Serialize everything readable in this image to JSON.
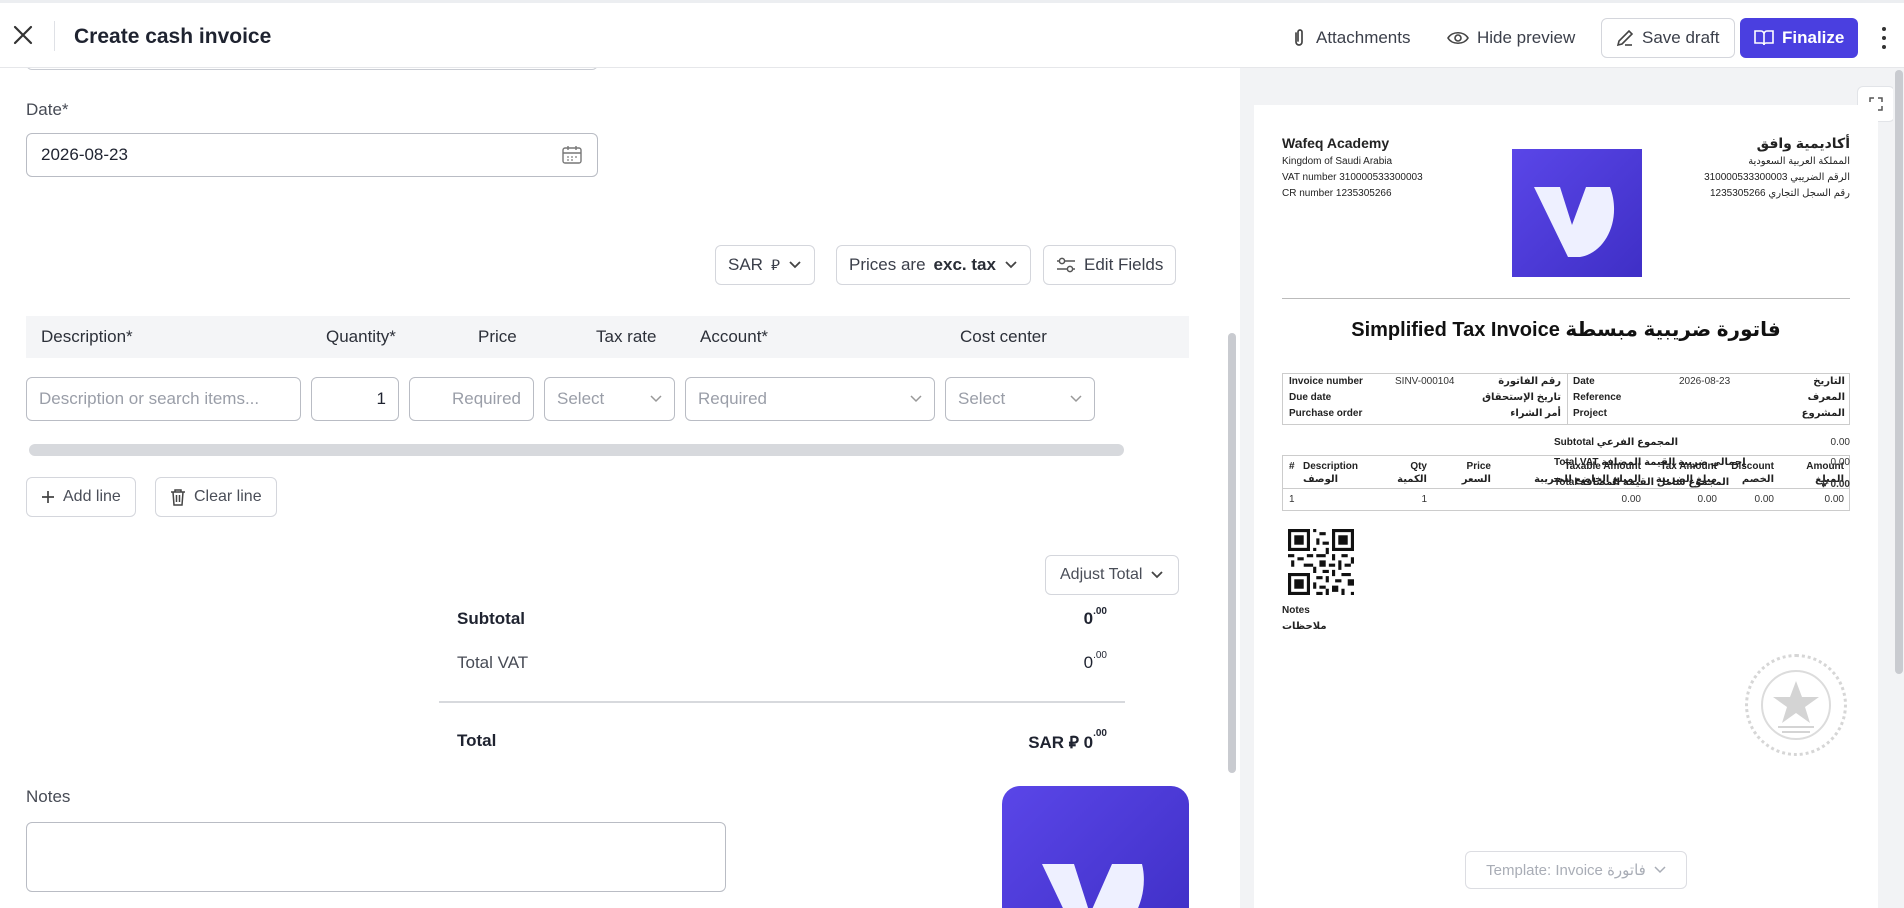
{
  "header": {
    "title": "Create cash invoice",
    "attachments_label": "Attachments",
    "hide_preview_label": "Hide preview",
    "save_draft_label": "Save draft",
    "finalize_label": "Finalize"
  },
  "form": {
    "date_label": "Date*",
    "date_value": "2026-08-23",
    "currency_label": "SAR",
    "currency_symbol": "⃁",
    "prices_prefix": "Prices are",
    "prices_mode": "exc. tax",
    "edit_fields_label": "Edit Fields",
    "columns": [
      "Description*",
      "Quantity*",
      "Price",
      "Tax rate",
      "Account*",
      "Cost center"
    ],
    "line": {
      "description_placeholder": "Description or search items...",
      "quantity": "1",
      "price_placeholder": "Required",
      "tax_placeholder": "Select",
      "account_placeholder": "Required",
      "cost_center_placeholder": "Select"
    },
    "add_line_label": "Add line",
    "clear_line_label": "Clear line",
    "adjust_total_label": "Adjust Total",
    "subtotal_label": "Subtotal",
    "subtotal_int": "0",
    "subtotal_dec": ".00",
    "vat_label": "Total VAT",
    "vat_int": "0",
    "vat_dec": ".00",
    "total_label": "Total",
    "total_prefix": "SAR ⃁ 0",
    "total_dec": ".00",
    "notes_label": "Notes"
  },
  "preview": {
    "company_en": "Wafeq Academy",
    "country_en": "Kingdom of Saudi Arabia",
    "vat_en": "VAT number 310000533300003",
    "cr_en": "CR number 1235305266",
    "company_ar": "أكاديمية وافق",
    "country_ar": "المملكة العربية السعودية",
    "vat_ar": "الرقم الضريبي 310000533300003",
    "cr_ar": "رقم السجل التجاري 1235305266",
    "title": "Simplified Tax Invoice فاتورة ضريبية مبسطة",
    "meta": {
      "invoice_number_label": "Invoice number",
      "invoice_number": "SINV-000104",
      "invoice_number_ar": "رقم الفاتورة",
      "due_date_label": "Due date",
      "due_date_ar": "تاريخ الإستحقاق",
      "po_label": "Purchase order",
      "po_ar": "أمر الشراء",
      "date_label": "Date",
      "date": "2026-08-23",
      "date_ar": "التاريخ",
      "reference_label": "Reference",
      "reference_ar": "المعرف",
      "project_label": "Project",
      "project_ar": "المشروع"
    },
    "items_headers": {
      "hash": "#",
      "description": "Description",
      "description_ar": "الوصف",
      "qty": "Qty",
      "qty_ar": "الكمية",
      "price": "Price",
      "price_ar": "السعر",
      "taxable": "Taxable Amount",
      "taxable_ar": "المبلغ الخاضع للضريبة",
      "tax_amount": "Tax Amount",
      "tax_amount_ar": "مبلغ الضريبة",
      "discount": "Discount",
      "discount_ar": "الخصم",
      "amount": "Amount",
      "amount_ar": "المبلغ"
    },
    "item_row": {
      "num": "1",
      "qty": "1",
      "taxable": "0.00",
      "tax": "0.00",
      "discount": "0.00",
      "amount": "0.00"
    },
    "subtotal_label": "Subtotal المجموع الفرعي",
    "subtotal": "0.00",
    "vat_label": "Total VAT إجمالي ضريبة القيمة المضافة",
    "vat": "0.00",
    "total_label": "Total المجموع شامل القيمة المضافة",
    "total": "⃁ 0.00",
    "notes_en": "Notes",
    "notes_ar": "ملاحظات",
    "template_label": "Template: Invoice فاتورة"
  },
  "colors": {
    "primary": "#4a3fe0",
    "border": "#b9bcc4",
    "preview_bg": "#f2f3f5"
  },
  "icons": [
    "close-icon",
    "paperclip-icon",
    "eye-icon",
    "draft-icon",
    "book-icon",
    "kebab-icon",
    "calendar-icon",
    "chevron-down-icon",
    "sliders-icon",
    "plus-icon",
    "trash-icon",
    "expand-icon",
    "star-stamp-icon"
  ]
}
